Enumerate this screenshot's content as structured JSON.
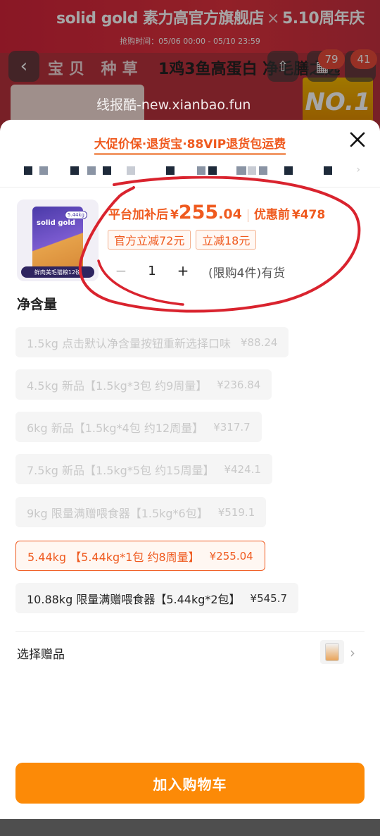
{
  "background": {
    "brand": "solid gold 素力高官方旗舰店",
    "brand_suffix": "5.10周年庆",
    "time_range": "抢购时间：05/06 00:00 - 05/10 23:59",
    "tabs": "宝贝 种草",
    "title": "1鸡3鱼高蛋白 净毛膳之选",
    "badges": [
      "79",
      "41"
    ],
    "watermark": "线报酷-new.xianbao.fun",
    "no1": "NO.1"
  },
  "sheet": {
    "promo_banner": "大促价保·退货宝·88VIP退货包运费",
    "product": {
      "thumb_logo": "solid gold",
      "thumb_weight": "5.44kg",
      "thumb_caption": "鲜肉美毛猫粮12磅",
      "price_label": "平台加补后",
      "price_symbol": "¥",
      "price_int": "255",
      "price_dec": ".04",
      "orig_label": "优惠前",
      "orig_price": "¥478",
      "coupons": [
        "官方立减72元",
        "立减18元"
      ],
      "quantity": "1",
      "minus": "−",
      "plus": "+",
      "stock_text": "(限购4件)有货"
    },
    "section_title": "净含量",
    "options": [
      {
        "label": "1.5kg 点击默认净含量按钮重新选择口味",
        "price": "¥88.24",
        "state": "disabled"
      },
      {
        "label": "4.5kg 新品【1.5kg*3包 约9周量】",
        "price": "¥236.84",
        "state": "disabled"
      },
      {
        "label": "6kg 新品【1.5kg*4包 约12周量】",
        "price": "¥317.7",
        "state": "disabled"
      },
      {
        "label": "7.5kg 新品【1.5kg*5包 约15周量】",
        "price": "¥424.1",
        "state": "disabled"
      },
      {
        "label": "9kg 限量满赠喂食器【1.5kg*6包】",
        "price": "¥519.1",
        "state": "disabled"
      },
      {
        "label": "5.44kg 【5.44kg*1包 约8周量】",
        "price": "¥255.04",
        "state": "selected"
      },
      {
        "label": "10.88kg 限量满赠喂食器【5.44kg*2包】",
        "price": "¥545.7",
        "state": "normal"
      }
    ],
    "gift_label": "选择赠品",
    "cart_button": "加入购物车"
  },
  "colors": {
    "accent": "#ef5a1f",
    "cart_button": "#fc8a07",
    "annotation_red": "#d9232e"
  },
  "icons": [
    "back-arrow-icon",
    "close-icon",
    "chevron-right-icon",
    "minus-icon",
    "plus-icon"
  ]
}
